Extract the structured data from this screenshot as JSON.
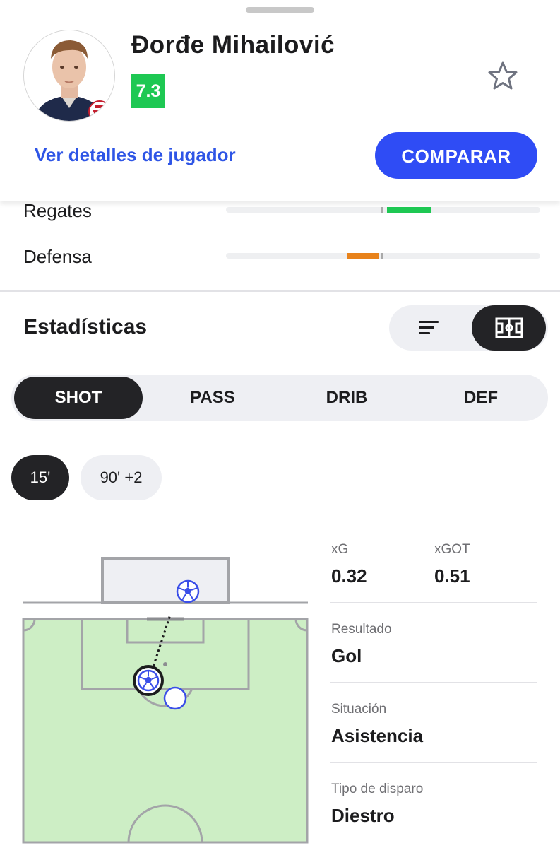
{
  "player": {
    "name": "Đorđe Mihailović",
    "rating": "7.3",
    "details_link": "Ver detalles de jugador",
    "compare_label": "COMPARAR"
  },
  "attributes": [
    {
      "label": "Regates",
      "value_fraction": 0.14,
      "direction": "positive",
      "color": "#1ec853"
    },
    {
      "label": "Defensa",
      "value_fraction": 0.1,
      "direction": "negative",
      "color": "#e8821a"
    }
  ],
  "stats_section": {
    "title": "Estadísticas",
    "view_options": [
      "list-icon",
      "pitch-icon"
    ],
    "active_view": "pitch-icon"
  },
  "tabs": [
    {
      "label": "SHOT",
      "active": true
    },
    {
      "label": "PASS",
      "active": false
    },
    {
      "label": "DRIB",
      "active": false
    },
    {
      "label": "DEF",
      "active": false
    }
  ],
  "shot_times": [
    {
      "label": "15'",
      "active": true
    },
    {
      "label": "90' +2",
      "active": false
    }
  ],
  "shot_details": {
    "xg_label": "xG",
    "xg_value": "0.32",
    "xgot_label": "xGOT",
    "xgot_value": "0.51",
    "result_label": "Resultado",
    "result_value": "Gol",
    "situation_label": "Situación",
    "situation_value": "Asistencia",
    "shot_type_label": "Tipo de disparo",
    "shot_type_value": "Diestro"
  },
  "colors": {
    "accent": "#2f4cf5",
    "rating_bg": "#1ec853",
    "pitch": "#cdeec5",
    "dark": "#232326"
  }
}
